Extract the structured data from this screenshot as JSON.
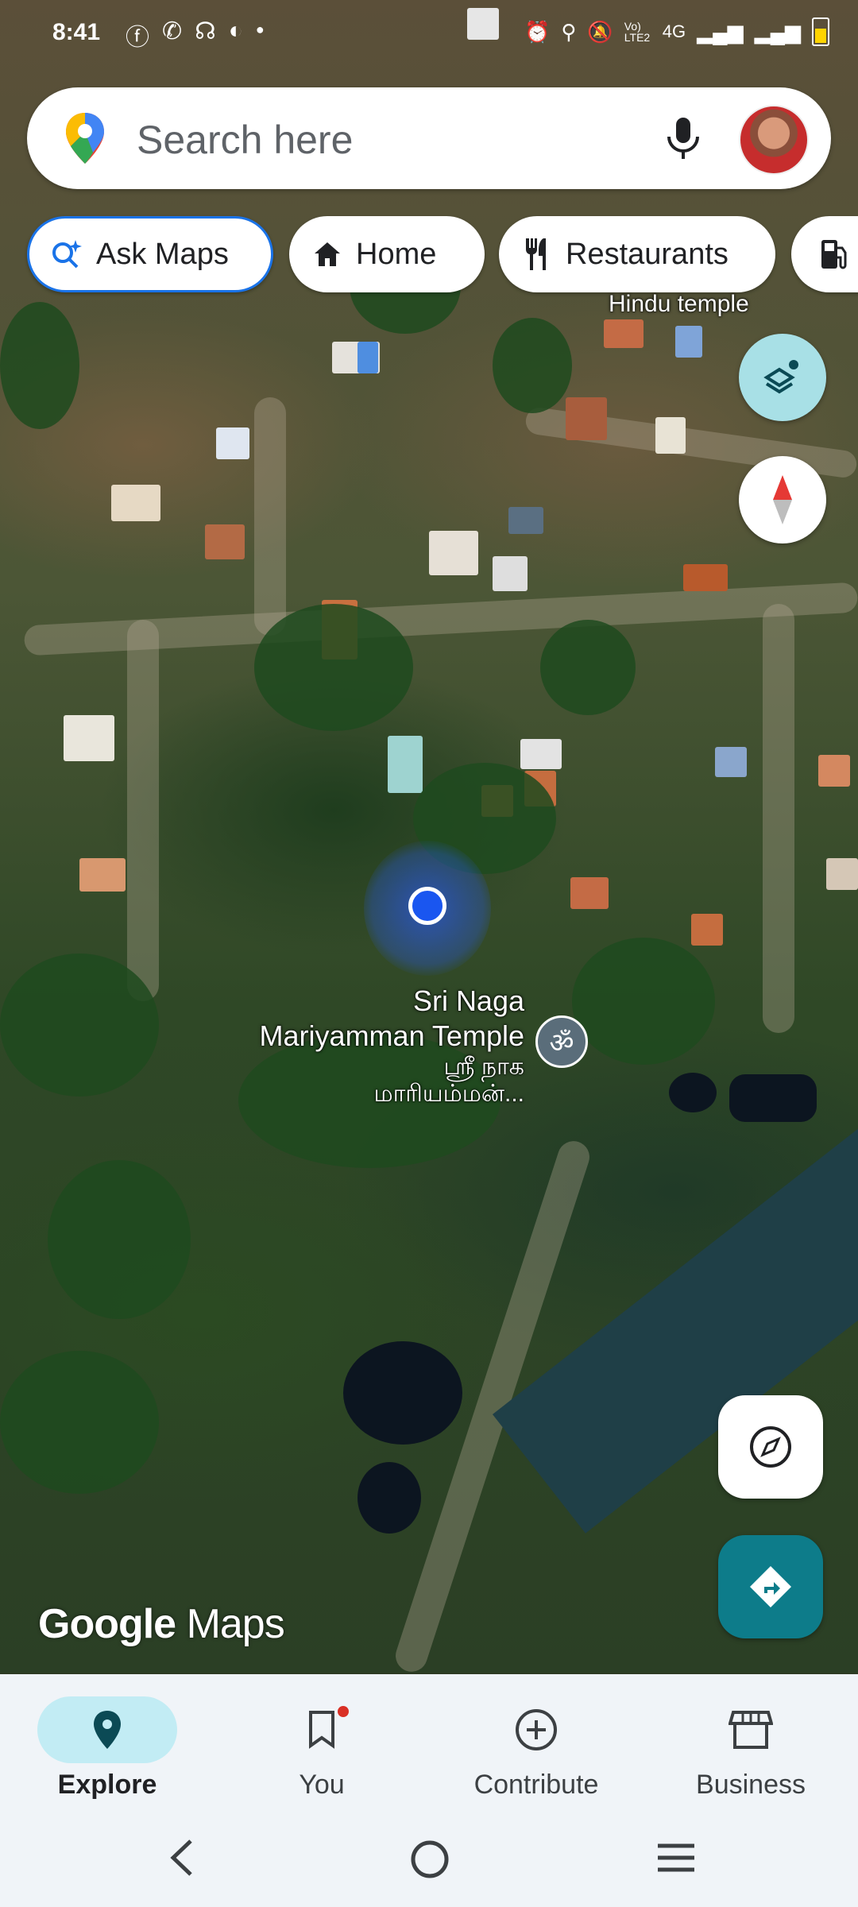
{
  "status_bar": {
    "time": "8:41",
    "network": "4G",
    "volte": "Vo) LTE2"
  },
  "search": {
    "placeholder": "Search here"
  },
  "chips": {
    "ask_maps": "Ask Maps",
    "home": "Home",
    "restaurants": "Restaurants"
  },
  "map": {
    "poi_hindu_temple": "Hindu temple",
    "temple_name_line1": "Sri Naga",
    "temple_name_line2": "Mariyamman Temple",
    "temple_tamil_line1": "ஸ்ரீ நாக",
    "temple_tamil_line2": "மாரியம்மன்...",
    "watermark_google": "Google",
    "watermark_maps": "Maps",
    "colors": {
      "location_dot": "#1a56f0",
      "directions_fab": "#0d7c8a",
      "layers_button": "#a8e0e6"
    }
  },
  "bottom_nav": {
    "items": [
      {
        "label": "Explore",
        "icon": "location-pin-icon",
        "active": true
      },
      {
        "label": "You",
        "icon": "bookmark-icon",
        "badge": true
      },
      {
        "label": "Contribute",
        "icon": "add-circle-icon"
      },
      {
        "label": "Business",
        "icon": "storefront-icon"
      }
    ]
  },
  "icons": {
    "mic": "microphone-icon",
    "layers": "layers-icon",
    "compass": "compass-icon",
    "navigation": "navigation-icon",
    "directions": "directions-icon"
  }
}
